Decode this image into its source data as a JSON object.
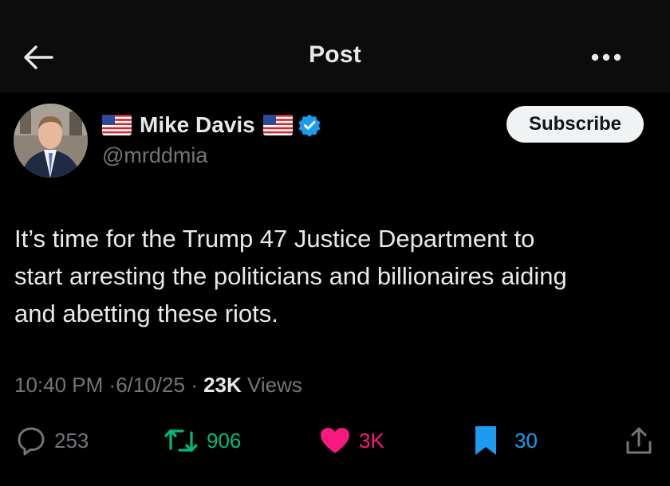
{
  "header": {
    "title": "Post",
    "back_icon": "arrow-left-icon",
    "more_icon": "more-horizontal-icon"
  },
  "post": {
    "author": {
      "display_name": "Mike Davis",
      "handle": "@mrddmia",
      "verified": true,
      "flag_icon": "us-flag-icon"
    },
    "subscribe_label": "Subscribe",
    "text_lines": [
      "It’s time for the Trump 47 Justice Department to",
      "start arresting the politicians and billionaires aiding",
      "and abetting these riots."
    ],
    "meta": {
      "time": "10:40 PM",
      "date": "6/10/25",
      "separator": "·",
      "views_count": "23K",
      "views_label": "Views"
    },
    "actions": {
      "replies": "253",
      "reposts": "906",
      "likes": "3K",
      "bookmarks": "30"
    }
  },
  "colors": {
    "background": "#000000",
    "header_bg": "#0c0c0c",
    "text": "#e7e9ea",
    "muted": "#71767b",
    "verified_blue": "#1d9bf0",
    "repost_green": "#00ba7c",
    "like_pink": "#f91880"
  }
}
